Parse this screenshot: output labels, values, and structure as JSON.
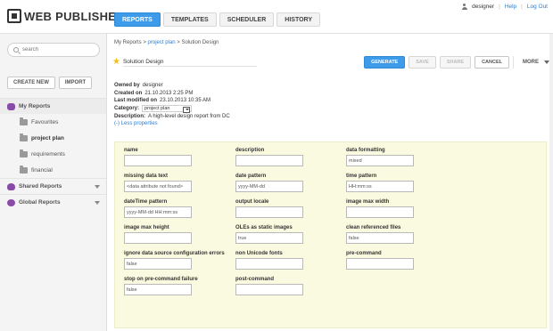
{
  "app": {
    "logo_text": "WEB PUBLISHER"
  },
  "nav": {
    "tabs": [
      {
        "label": "REPORTS",
        "active": true
      },
      {
        "label": "TEMPLATES",
        "active": false
      },
      {
        "label": "SCHEDULER",
        "active": false
      },
      {
        "label": "HISTORY",
        "active": false
      }
    ]
  },
  "userbar": {
    "username": "designer",
    "help": "Help",
    "logout": "Log Out"
  },
  "sidebar": {
    "search_placeholder": "search",
    "create_new": "CREATE NEW",
    "import": "IMPORT",
    "my_reports": "My Reports",
    "items": [
      {
        "label": "Favourites"
      },
      {
        "label": "project plan"
      },
      {
        "label": "requirements"
      },
      {
        "label": "financial"
      }
    ],
    "shared_reports": "Shared Reports",
    "global_reports": "Global Reports"
  },
  "breadcrumb": {
    "root": "My Reports",
    "sep1": ">",
    "folder": "project plan",
    "sep2": ">",
    "current": "Solution Design"
  },
  "report": {
    "title": "Solution Design",
    "owned_by_label": "Owned by",
    "owned_by": "designer",
    "created_on_label": "Created on",
    "created_on": "21.10.2013 2:25 PM",
    "last_modified_label": "Last modified on",
    "last_modified": "23.10.2013 10:35 AM",
    "category_label": "Category:",
    "category": "project plan",
    "description_label": "Description:",
    "description": "A high-level design report from DC",
    "less_link": "(-) Less properties"
  },
  "actions": {
    "generate": "GENERATE",
    "save": "SAVE",
    "share": "SHARE",
    "cancel": "CANCEL",
    "more": "MORE"
  },
  "properties": [
    {
      "label": "name",
      "value": ""
    },
    {
      "label": "description",
      "value": ""
    },
    {
      "label": "data formatting",
      "value": "mixed"
    },
    {
      "label": "missing data text",
      "value": "<data attribute not found>"
    },
    {
      "label": "date pattern",
      "value": "yyyy-MM-dd"
    },
    {
      "label": "time pattern",
      "value": "HH:mm:ss"
    },
    {
      "label": "dateTime pattern",
      "value": "yyyy-MM-dd HH:mm:ss"
    },
    {
      "label": "output locale",
      "value": ""
    },
    {
      "label": "image max width",
      "value": ""
    },
    {
      "label": "image max height",
      "value": ""
    },
    {
      "label": "OLEs as static images",
      "value": "true"
    },
    {
      "label": "clean referenced files",
      "value": "false"
    },
    {
      "label": "ignore data source configuration errors",
      "value": "false"
    },
    {
      "label": "non Unicode fonts",
      "value": ""
    },
    {
      "label": "pre-command",
      "value": ""
    },
    {
      "label": "stop on pre-command failure",
      "value": "false"
    },
    {
      "label": "post-command",
      "value": ""
    }
  ],
  "colors": {
    "accent": "#3d9be9",
    "link": "#2a7fd4",
    "panel": "#fafae0",
    "sidebar_icon": "#8a4aa8",
    "star": "#f3c20b"
  }
}
